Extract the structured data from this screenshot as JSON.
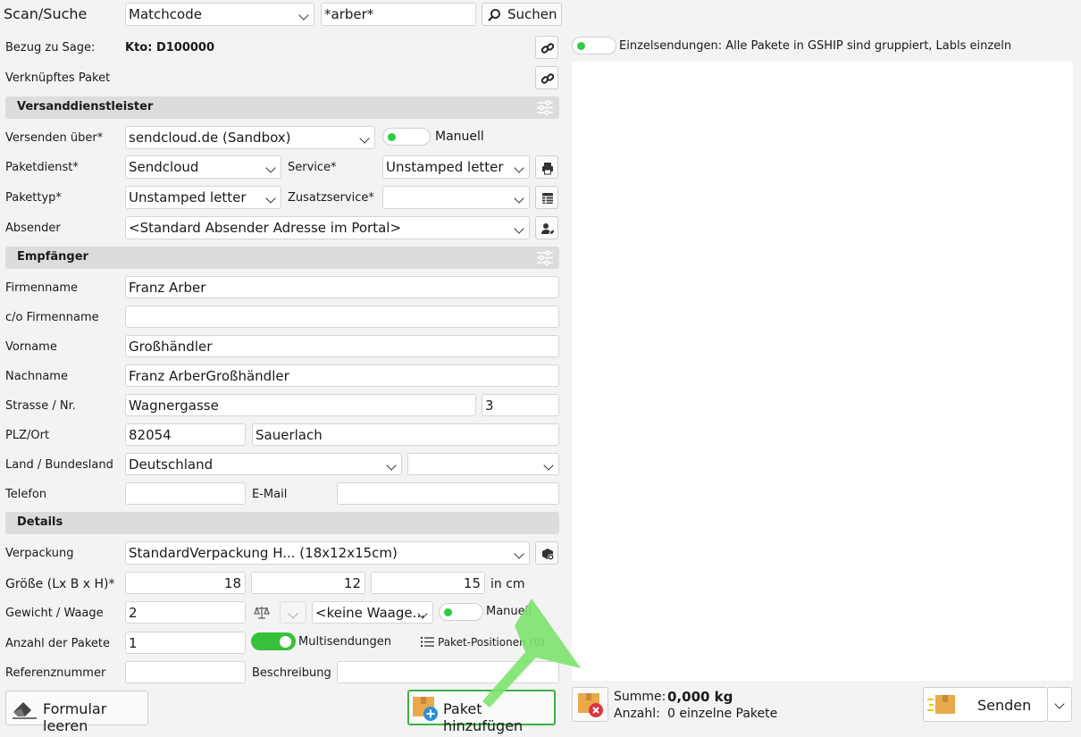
{
  "scan": {
    "label": "Scan/Suche",
    "mode": "Matchcode",
    "query": "*arber*",
    "search_label": "Suchen"
  },
  "bezug": {
    "label": "Bezug zu Sage:",
    "value": "Kto: D100000"
  },
  "verknuepft": {
    "label": "Verknüpftes Paket"
  },
  "einzel": {
    "text": "Einzelsendungen: Alle Pakete in GSHIP sind gruppiert, Labls einzeln"
  },
  "versand": {
    "title": "Versanddienstleister",
    "versenden_label": "Versenden über*",
    "versenden_value": "sendcloud.de (Sandbox)",
    "manuell_label": "Manuell",
    "paketdienst_label": "Paketdienst*",
    "paketdienst_value": "Sendcloud",
    "service_label": "Service*",
    "service_value": "Unstamped letter",
    "pakettyp_label": "Pakettyp*",
    "pakettyp_value": "Unstamped letter",
    "zusatz_label": "Zusatzservice*",
    "zusatz_value": "",
    "absender_label": "Absender",
    "absender_value": "<Standard Absender Adresse im Portal>"
  },
  "empfaenger": {
    "title": "Empfänger",
    "firma_label": "Firmenname",
    "firma_value": "Franz Arber",
    "co_label": "c/o Firmenname",
    "co_value": "",
    "vorname_label": "Vorname",
    "vorname_value": "Großhändler",
    "nachname_label": "Nachname",
    "nachname_value": "Franz ArberGroßhändler",
    "strasse_label": "Strasse / Nr.",
    "strasse_value": "Wagnergasse",
    "nr_value": "3",
    "plz_label": "PLZ/Ort",
    "plz_value": "82054",
    "ort_value": "Sauerlach",
    "land_label": "Land / Bundesland",
    "land_value": "Deutschland",
    "bundesland_value": "",
    "telefon_label": "Telefon",
    "telefon_value": "",
    "email_label": "E-Mail",
    "email_value": ""
  },
  "details": {
    "title": "Details",
    "verpackung_label": "Verpackung",
    "verpackung_value": "StandardVerpackung H... (18x12x15cm)",
    "groesse_label": "Größe (Lx B x H)*",
    "l": "18",
    "b": "12",
    "h": "15",
    "unit": "in cm",
    "gewicht_label": "Gewicht / Waage",
    "gewicht_value": "2",
    "waage_value": "<keine Waage...",
    "manuell_label": "Manuell",
    "anzahl_label": "Anzahl der Pakete",
    "anzahl_value": "1",
    "multi_label": "Multisendungen",
    "positionen_label": "Paket-Positionen (0)",
    "referenz_label": "Referenznummer",
    "referenz_value": "",
    "beschreibung_label": "Beschreibung",
    "beschreibung_value": ""
  },
  "footer": {
    "clear_label": "Formular leeren",
    "add_label": "Paket hinzufügen",
    "summe_label": "Summe:",
    "summe_value": "0,000 kg",
    "anzahl_label": "Anzahl:",
    "anzahl_value": "0 einzelne Pakete",
    "send_label": "Senden"
  },
  "colors": {
    "accent_green": "#35c13c",
    "add_border": "#3cb043",
    "pointer": "#7be36b",
    "box": "#e9a94b"
  }
}
